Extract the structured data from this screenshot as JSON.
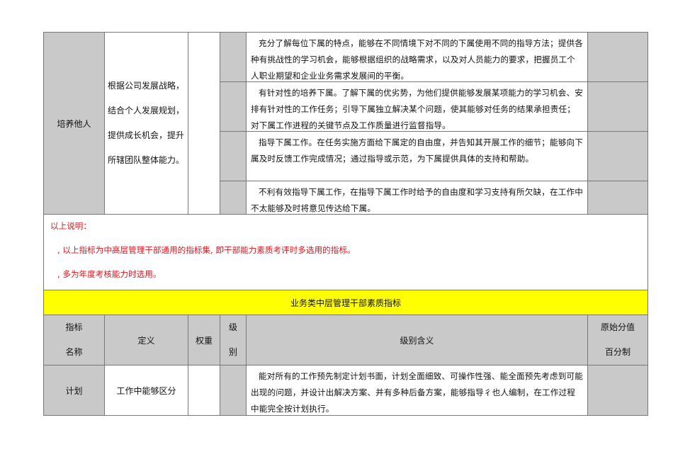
{
  "section1": {
    "indicator": "培养他人",
    "definition_lines": [
      "根据公司发展战略，",
      "结合个人发展规划，",
      "提供成长机会，提升",
      "所辖团队整体能力。"
    ],
    "levels": [
      "充分了解每位下属的特点，能够在不同情境下对不同的下属使用不同的指导方法；提供各种有挑战性的学习机会，能够根据组织的战略需求，以及对人员能力的要求，把握员工个人职业期望和企业业务需求发展间的平衡。",
      "有针对性的培养下属。了解下属的优劣势，为他们提供能够发展某项能力的学习机会、安排有针对性的工作任务；引导下属独立解决某个问题，使其能够对任务的结果承担责任；对下属工作进程的关键节点及工作质量进行监督指导。",
      "指导下属工作。在任务实施方面给下属定的自由度，并告知其开展工作的细节；能够向下属及时反馈工作完成情况；通过指导或示范，为下属提供具体的支持和帮助。",
      "不利有效指导下属工作，在指导下属工作时给予的自由度和学习支持有所欠缺，在工作中不太能够及时将意见传达给下属。"
    ]
  },
  "notes": {
    "title": "以上说明：",
    "items": [
      ", 以上指标为中高层管理干部通用的指标集, 即干部能力素质考评时多选用的指标。",
      ", 多为年度考核能力时选用。"
    ]
  },
  "section2": {
    "title": "业务类中层管理干部素质指标",
    "headers": {
      "indicator": [
        "指标",
        "名称"
      ],
      "definition": "定义",
      "weight": "权重",
      "level": [
        "级",
        "别"
      ],
      "meaning": "级别含义",
      "score": [
        "原始分值",
        "百分制"
      ]
    },
    "row": {
      "indicator": "计划",
      "definition": "工作中能够区分",
      "level_text": "能对所有的工作预先制定计划书面，计划全面细致、可操作性强、能全面预先考虑到可能出现的问题，并设计出解决方案、并有多种后备方案，能够指导彳也人编制，在工作过程中能完全按计划执行。"
    }
  }
}
